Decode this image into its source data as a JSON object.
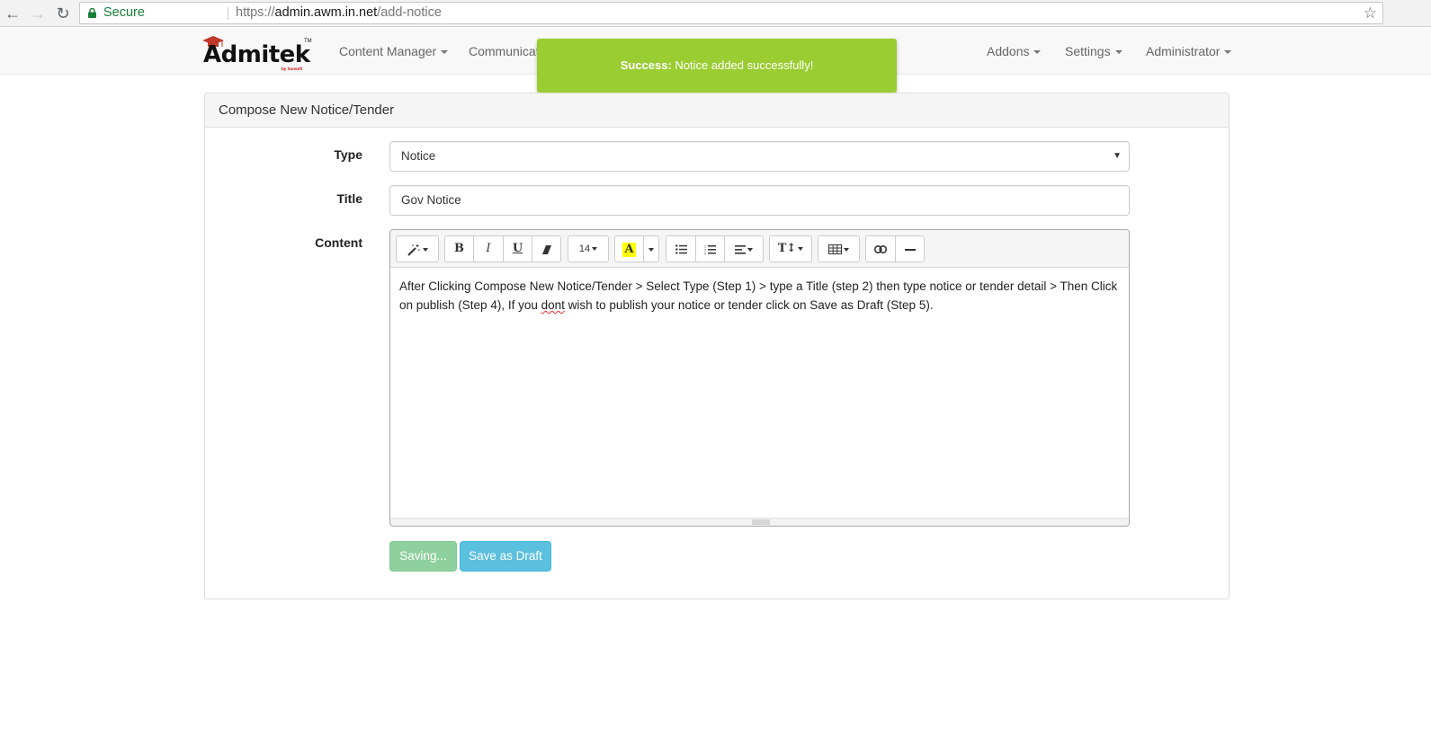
{
  "browser": {
    "back": "←",
    "forward": "→",
    "reload": "↻",
    "secure_label": "Secure",
    "url_scheme": "https://",
    "url_host": "admin.awm.in.net",
    "url_path": "/add-notice",
    "bookmark": "☆"
  },
  "navbar": {
    "brand": "Admitek",
    "brand_tm": "TM",
    "brand_sub": "by Sunsoft",
    "left_items": [
      "Content Manager",
      "Communicat"
    ],
    "right_items": [
      "Addons",
      "Settings",
      "Administrator"
    ]
  },
  "toast": {
    "title": "Success:",
    "message": " Notice added successfully!",
    "color": "#9acd32"
  },
  "panel": {
    "heading": "Compose New Notice/Tender",
    "type_label": "Type",
    "type_value": "Notice",
    "title_label": "Title",
    "title_value": "Gov Notice",
    "content_label": "Content"
  },
  "editor": {
    "font_size": "14",
    "bold": "B",
    "italic": "I",
    "underline": "U",
    "font_color_glyph": "A",
    "text_height_glyph": "T↕",
    "content_part1": "After Clicking Compose New Notice/Tender > Select Type (Step 1) > type a Title (step 2) then type notice or tender detail > Then Click on publish (Step 4), If you ",
    "content_misspelled": "dont",
    "content_part2": " wish to publish your notice or tender click on Save as Draft (Step 5)."
  },
  "actions": {
    "saving_label": "Saving...",
    "draft_label": "Save as Draft"
  },
  "colors": {
    "saving_button": "#8fd19e",
    "draft_button": "#5bc0de",
    "font_highlight": "#ffff00"
  }
}
